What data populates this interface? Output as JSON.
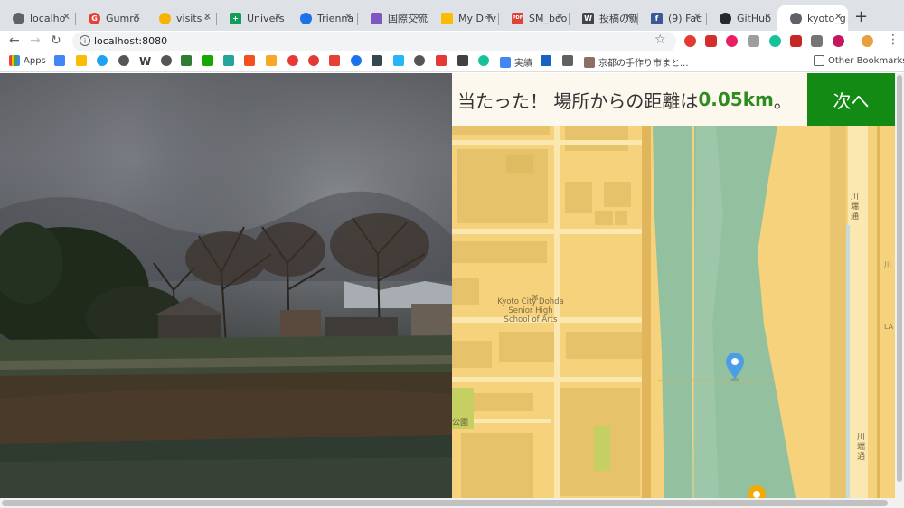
{
  "tabs": [
    {
      "label": "localho",
      "icon": "globe-icon",
      "color": "#5f6368"
    },
    {
      "label": "Gumro",
      "icon": "gumroad-icon",
      "color": "#e34234"
    },
    {
      "label": "visits -",
      "icon": "visits-icon",
      "color": "#f4b400"
    },
    {
      "label": "Univers",
      "icon": "sheets-icon",
      "color": "#0f9d58"
    },
    {
      "label": "Trienna",
      "icon": "globe-blue-icon",
      "color": "#1a73e8"
    },
    {
      "label": "国際交流",
      "icon": "purple-icon",
      "color": "#7e57c2"
    },
    {
      "label": "My Driv",
      "icon": "drive-icon",
      "color": "#fbbc04"
    },
    {
      "label": "SM_boo",
      "icon": "pdf-icon",
      "color": "#db4437"
    },
    {
      "label": "投稿の新",
      "icon": "w-icon",
      "color": "#444444"
    },
    {
      "label": "(9) Fac",
      "icon": "facebook-icon",
      "color": "#3b5998"
    },
    {
      "label": "GitHub",
      "icon": "github-icon",
      "color": "#24292e"
    },
    {
      "label": "kyoto_g",
      "icon": "globe-icon",
      "color": "#5f6368"
    }
  ],
  "toolbar": {
    "url": "localhost:8080"
  },
  "bookmarks": {
    "apps": "Apps",
    "jisseki": "実績",
    "kyoto_link": "京都の手作り市まと...",
    "other": "Other Bookmarks"
  },
  "result": {
    "prefix": "当たった！ 場所からの距離は ",
    "distance": "0.05km",
    "suffix": "。"
  },
  "next_button": "次へ",
  "map": {
    "school_label_line1": "Kyoto City Dohda",
    "school_label_line2": "Senior High",
    "school_label_line3": "School of Arts",
    "park_label": "公園",
    "street_top": "川端通",
    "street_bottom": "川端通",
    "edge_label_1": "川",
    "edge_label_2": "LA",
    "colors": {
      "land": "#f6d27c",
      "building": "#e6c36a",
      "river": "#93c1a0",
      "road": "#fbe8b0",
      "park": "#c5cf62",
      "pin_blue": "#4a9ee8",
      "pin_orange": "#f2a900"
    }
  }
}
